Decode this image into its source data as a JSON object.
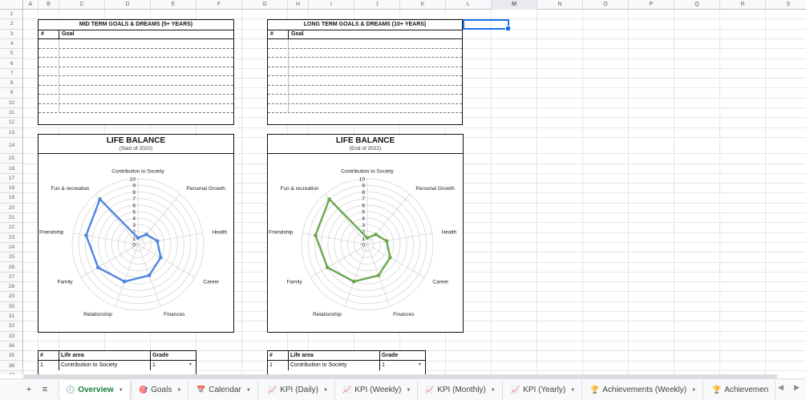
{
  "columns": [
    "A",
    "B",
    "C",
    "D",
    "E",
    "F",
    "G",
    "H",
    "I",
    "J",
    "K",
    "L",
    "M",
    "N",
    "O",
    "P",
    "Q",
    "R",
    "S"
  ],
  "rows": [
    "1",
    "2",
    "3",
    "4",
    "5",
    "6",
    "7",
    "8",
    "9",
    "10",
    "11",
    "12",
    "13",
    "14",
    "15",
    "16",
    "17",
    "18",
    "19",
    "20",
    "21",
    "22",
    "23",
    "24",
    "25",
    "26",
    "27",
    "28",
    "29",
    "30",
    "31",
    "32",
    "33",
    "34",
    "35",
    "36",
    "37"
  ],
  "selected_column": "M",
  "mid_goals": {
    "title": "MID TERM GOALS & DREAMS (5+ YEARS)",
    "hash": "#",
    "goal_label": "Goal"
  },
  "long_goals": {
    "title": "LONG TERM GOALS & DREAMS (10+ YEARS)",
    "hash": "#",
    "goal_label": "Goal"
  },
  "chart_data": [
    {
      "type": "radar",
      "title": "LIFE BALANCE",
      "subtitle": "(Start of 2022)",
      "categories": [
        "Contribution to Society",
        "Personal Growth",
        "Health",
        "Career",
        "Finances",
        "Relationship",
        "Family",
        "Friendship",
        "Fun & recreation"
      ],
      "ticks": [
        "0",
        "1",
        "2",
        "3",
        "4",
        "5",
        "6",
        "7",
        "8",
        "9",
        "10"
      ],
      "range": [
        0,
        10
      ],
      "series": [
        {
          "values": [
            1,
            2,
            3,
            4,
            5,
            6,
            7,
            8,
            9
          ],
          "color": "#4f86e0"
        }
      ]
    },
    {
      "type": "radar",
      "title": "LIFE BALANCE",
      "subtitle": "(End of 2022)",
      "categories": [
        "Contribution to Society",
        "Personal Growth",
        "Health",
        "Career",
        "Finances",
        "Relationship",
        "Family",
        "Friendship",
        "Fun & recreation"
      ],
      "ticks": [
        "0",
        "1",
        "2",
        "3",
        "4",
        "5",
        "6",
        "7",
        "8",
        "9",
        "10"
      ],
      "range": [
        0,
        10
      ],
      "series": [
        {
          "values": [
            1,
            2,
            3,
            4,
            5,
            6,
            7,
            8,
            9
          ],
          "color": "#6aa84f"
        }
      ]
    }
  ],
  "life_area_left": {
    "hash": "#",
    "area": "Life area",
    "grade": "Grade",
    "row": {
      "n": "1",
      "area": "Contribution to Society",
      "grade": "1"
    }
  },
  "life_area_right": {
    "hash": "#",
    "area": "Life area",
    "grade": "Grade",
    "row": {
      "n": "1",
      "area": "Contribution to Society",
      "grade": "1"
    }
  },
  "sheetbar": {
    "add": "+",
    "all_sheets": "≡",
    "tabs": [
      {
        "label": "Overview",
        "icon": "🕗",
        "active": true
      },
      {
        "label": "Goals",
        "icon": "🎯"
      },
      {
        "label": "Calendar",
        "icon": "📅"
      },
      {
        "label": "KPI (Daily)",
        "icon": "📈"
      },
      {
        "label": "KPI (Weekly)",
        "icon": "📈"
      },
      {
        "label": "KPI (Monthly)",
        "icon": "📈"
      },
      {
        "label": "KPI (Yearly)",
        "icon": "📈"
      },
      {
        "label": "Achievements (Weekly)",
        "icon": "🏆"
      },
      {
        "label": "Achievemen",
        "icon": "🏆"
      }
    ]
  }
}
